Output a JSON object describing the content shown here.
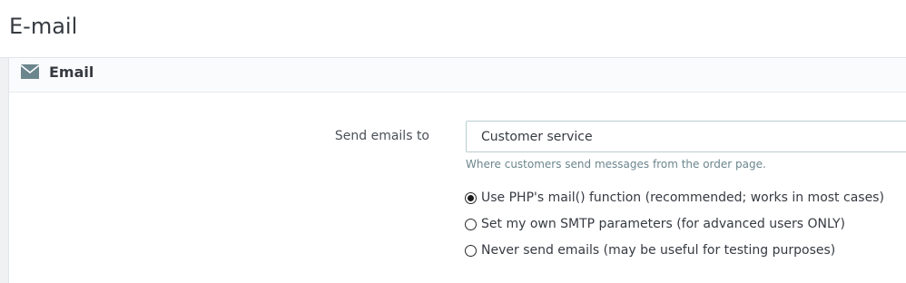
{
  "page": {
    "title": "E-mail"
  },
  "panel": {
    "title": "Email",
    "icon": "envelope-icon"
  },
  "send_to": {
    "label": "Send emails to",
    "selected": "Customer service",
    "help": "Where customers send messages from the order page."
  },
  "mail_method": {
    "options": [
      {
        "label": "Use PHP's mail() function (recommended; works in most cases)",
        "checked": true
      },
      {
        "label": "Set my own SMTP parameters (for advanced users ONLY)",
        "checked": false
      },
      {
        "label": "Never send emails (may be useful for testing purposes)",
        "checked": false
      }
    ]
  },
  "colors": {
    "icon": "#6c868e",
    "text": "#363a41",
    "help": "#6c868e"
  }
}
